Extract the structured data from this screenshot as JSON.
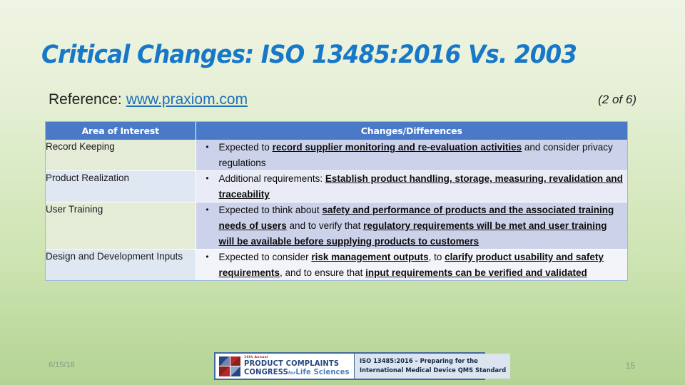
{
  "slide": {
    "title": "Critical Changes:  ISO 13485:2016 Vs. 2003",
    "reference_label": "Reference:",
    "reference_link": "www.praxiom.com",
    "page_count": "(2 of 6)",
    "date": "6/15/18",
    "slide_number": "15",
    "accent_blue": "#1878c8",
    "header_blue": "#4a7ac7",
    "link_blue": "#1f6fb8"
  },
  "table": {
    "headers": [
      "Area of Interest",
      "Changes/Differences"
    ],
    "rows": [
      {
        "area": "Record Keeping",
        "bullet": "•",
        "segments": [
          {
            "text": "Expected to ",
            "emphasis": false
          },
          {
            "text": "record supplier monitoring and re-evaluation activities",
            "emphasis": true
          },
          {
            "text": " and consider privacy regulations",
            "emphasis": false
          }
        ]
      },
      {
        "area": "Product Realization",
        "bullet": "•",
        "segments": [
          {
            "text": "Additional requirements:  ",
            "emphasis": false
          },
          {
            "text": "Establish product handling, storage, measuring, revalidation and traceability",
            "emphasis": true
          }
        ]
      },
      {
        "area": "User Training",
        "bullet": "•",
        "segments": [
          {
            "text": "Expected to think about ",
            "emphasis": false
          },
          {
            "text": "safety and performance of products and the associated training needs of users",
            "emphasis": true
          },
          {
            "text": " and to verify that ",
            "emphasis": false
          },
          {
            "text": "regulatory requirements will be met and user training will be available before supplying products to customers",
            "emphasis": true
          }
        ]
      },
      {
        "area": "Design and Development Inputs",
        "bullet": "•",
        "segments": [
          {
            "text": "Expected to consider ",
            "emphasis": false
          },
          {
            "text": "risk management outputs",
            "emphasis": true
          },
          {
            "text": ", to ",
            "emphasis": false
          },
          {
            "text": "clarify product usability and safety requirements",
            "emphasis": true
          },
          {
            "text": ", and to ensure that ",
            "emphasis": false
          },
          {
            "text": "input requirements can be verified and validated",
            "emphasis": true
          }
        ]
      }
    ]
  },
  "footer_badge": {
    "annual": "16th Annual",
    "line1": "PRODUCT COMPLAINTS",
    "line2_main": "CONGRESS",
    "line2_for": "for",
    "line2_tail": "Life Sciences",
    "iso_line1": "ISO 13485:2016 – Preparing for the",
    "iso_line2": "International Medical Device QMS Standard"
  }
}
